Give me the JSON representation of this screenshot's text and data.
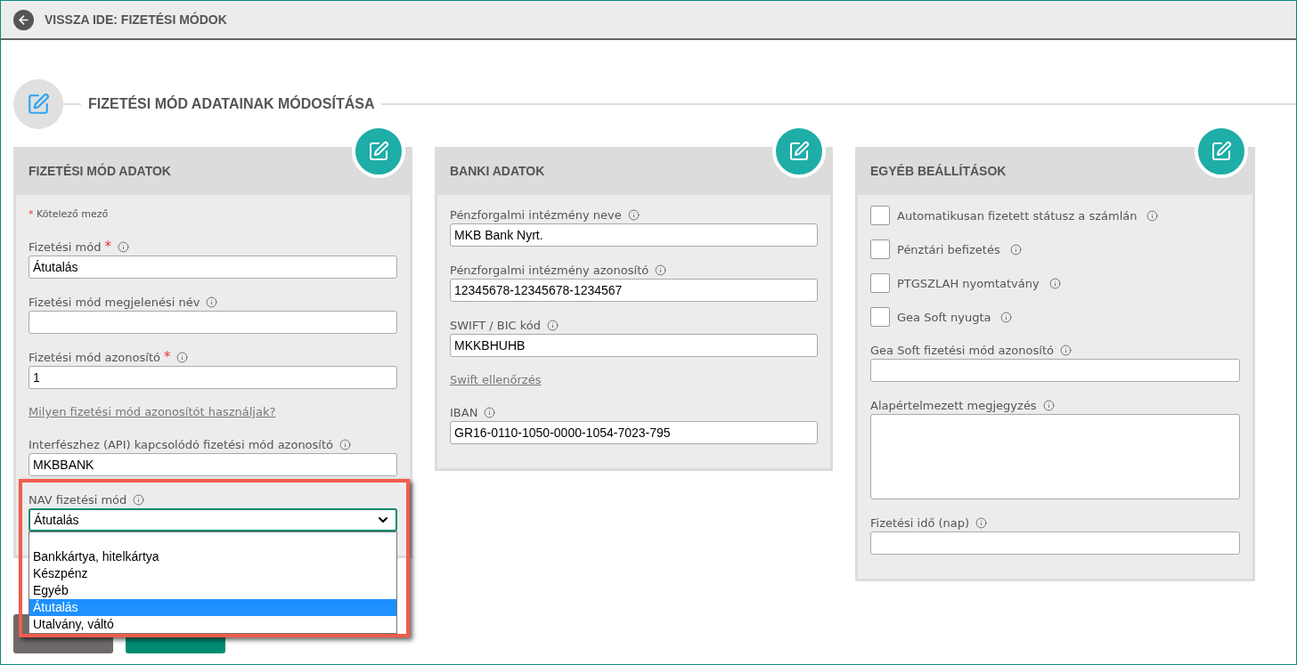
{
  "back_bar": {
    "label": "VISSZA IDE: FIZETÉSI MÓDOK"
  },
  "section": {
    "title": "FIZETÉSI MÓD ADATAINAK MÓDOSÍTÁSA"
  },
  "panels": [
    {
      "title": "FIZETÉSI MÓD ADATOK",
      "required_note": {
        "mark": "*",
        "text": "Kötelező mező"
      },
      "fields": [
        {
          "kind": "input",
          "label": "Fizetési mód",
          "required_mark": "*",
          "value": "Átutalás"
        },
        {
          "kind": "input",
          "label": "Fizetési mód megjelenési név"
        },
        {
          "kind": "input",
          "label": "Fizetési mód azonosító",
          "required_mark": "*",
          "value": "1"
        },
        {
          "kind": "link",
          "label": "Milyen fizetési mód azonosítót használjak?"
        },
        {
          "kind": "input",
          "label": "Interfészhez (API) kapcsolódó fizetési mód azonosító",
          "value": "MKBBANK"
        },
        {
          "kind": "select",
          "label": "NAV fizetési mód",
          "value": "Átutalás",
          "highlighted": true,
          "expanded": true,
          "options": [
            {
              "label": "Bankkártya, hitelkártya",
              "selected": false
            },
            {
              "label": "Készpénz",
              "selected": false
            },
            {
              "label": "Egyéb",
              "selected": false
            },
            {
              "label": "Átutalás",
              "selected": true
            },
            {
              "label": "Utalvány, váltó",
              "selected": false
            }
          ]
        }
      ]
    },
    {
      "title": "BANKI ADATOK",
      "fields": [
        {
          "kind": "input",
          "label": "Pénzforgalmi intézmény neve",
          "value": "MKB Bank Nyrt."
        },
        {
          "kind": "input",
          "label": "Pénzforgalmi intézmény azonosító",
          "value": "12345678-12345678-1234567"
        },
        {
          "kind": "input",
          "label": "SWIFT / BIC kód",
          "value": "MKKBHUHB"
        },
        {
          "kind": "link",
          "label": "Swift ellenőrzés"
        },
        {
          "kind": "input",
          "label": "IBAN",
          "value": "GR16-0110-1050-0000-1054-7023-795"
        }
      ]
    },
    {
      "title": "EGYÉB BEÁLLÍTÁSOK",
      "fields": [
        {
          "kind": "checkbox",
          "label": "Automatikusan fizetett státusz a számlán",
          "checked": false
        },
        {
          "kind": "checkbox",
          "label": "Pénztári befizetés",
          "checked": false
        },
        {
          "kind": "checkbox",
          "label": "PTGSZLAH nyomtatvány",
          "checked": false
        },
        {
          "kind": "checkbox",
          "label": "Gea Soft nyugta",
          "checked": false
        },
        {
          "kind": "input",
          "label": "Gea Soft fizetési mód azonosító"
        },
        {
          "kind": "textarea",
          "label": "Alapértelmezett megjegyzés"
        },
        {
          "kind": "input",
          "label": "Fizetési idő (nap)"
        }
      ]
    }
  ]
}
